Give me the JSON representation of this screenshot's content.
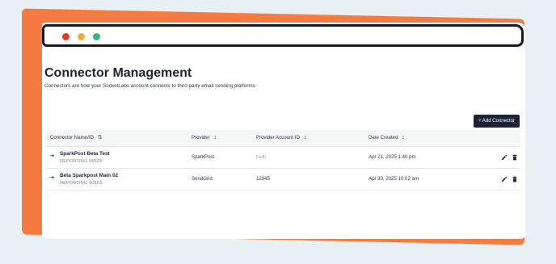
{
  "page": {
    "title": "Connector Management",
    "subtitle": "Connectors are how your SocketLabs account connects to third party email sending platforms"
  },
  "toolbar": {
    "add_label": "+ Add Connector"
  },
  "table": {
    "columns": [
      {
        "label": "Connector Name/ID",
        "sort_icon": "⇅"
      },
      {
        "label": "Provider",
        "sort_icon": "↕"
      },
      {
        "label": "Provider Account ID",
        "sort_icon": "↕"
      },
      {
        "label": "Date Created",
        "sort_icon": "↕"
      }
    ],
    "rows": [
      {
        "name": "SparkPost Beta Test",
        "reporting_id": "REPORTING 50524",
        "provider": "SparkPost",
        "account_id": "[null]",
        "date_created": "Apr 21, 2025 1:40 pm"
      },
      {
        "name": "Beta Sparkpost Main 02",
        "reporting_id": "REPORTING 50553",
        "provider": "SendGrid",
        "account_id": "12345",
        "date_created": "Apr 30, 2025 10:02 am"
      }
    ]
  },
  "icons": {
    "row_expand": "arrow-right-to-bar-icon",
    "edit": "pencil-icon",
    "delete": "trash-icon"
  },
  "colors": {
    "accent": "#f47b42",
    "button_bg": "#1c2238",
    "window_close": "#e8392b",
    "window_minimize": "#f4a83a",
    "window_maximize": "#36b37e"
  }
}
